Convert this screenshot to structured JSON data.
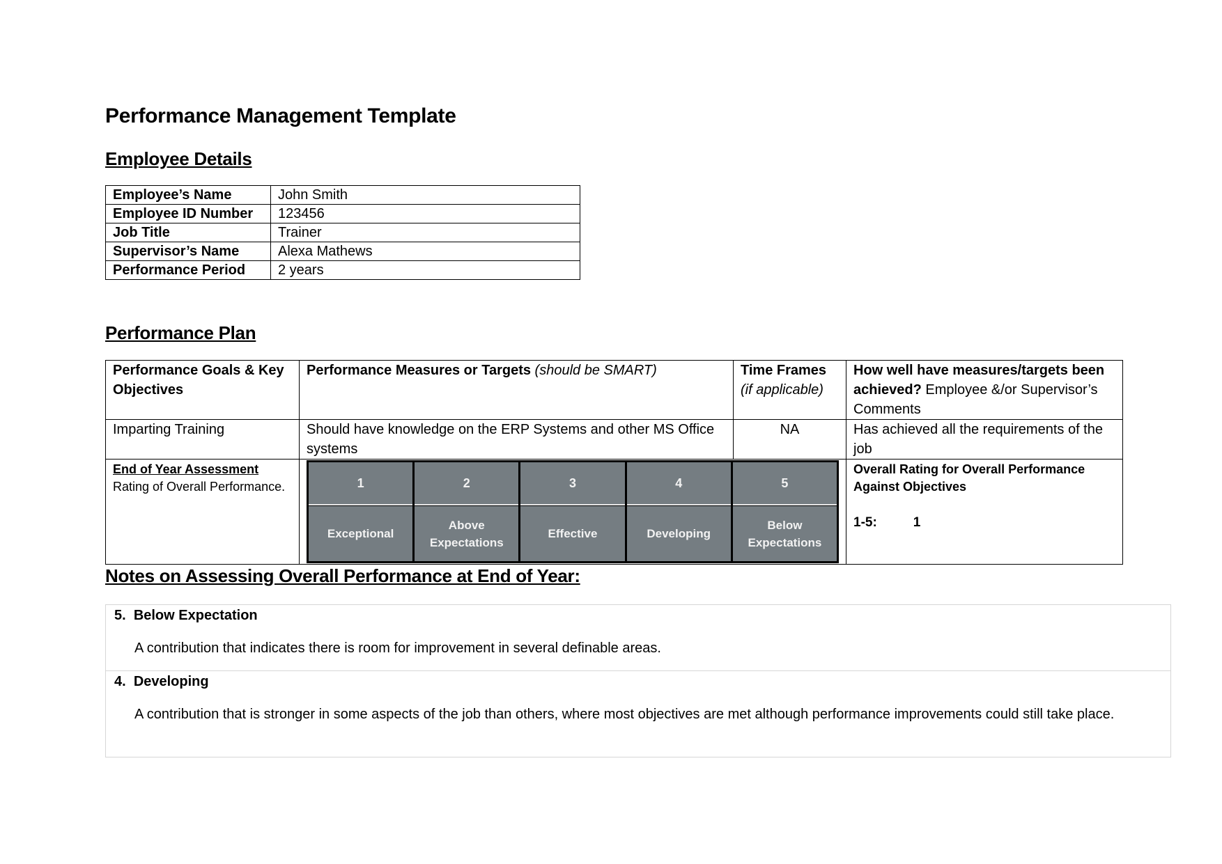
{
  "document": {
    "title": "Performance Management Template"
  },
  "employee_details": {
    "heading": "Employee Details",
    "rows": [
      {
        "label": "Employee’s Name",
        "value": "John Smith"
      },
      {
        "label": "Employee ID Number",
        "value": "123456"
      },
      {
        "label": "Job Title",
        "value": "Trainer"
      },
      {
        "label": "Supervisor’s Name",
        "value": "Alexa Mathews"
      },
      {
        "label": "Performance Period",
        "value": "2 years"
      }
    ]
  },
  "performance_plan": {
    "heading": "Performance Plan",
    "headers": {
      "goals": "Performance Goals & Key Objectives",
      "measures_bold": "Performance Measures or Targets",
      "measures_italic": "(should be SMART)",
      "timeframes_bold": "Time Frames",
      "timeframes_italic": "(if applicable)",
      "achieved_bold": "How well have measures/targets been achieved?",
      "achieved_rest": "Employee &/or Supervisor’s Comments"
    },
    "rows": [
      {
        "goal": "Imparting Training",
        "measure": "Should have knowledge on the ERP Systems and other MS Office systems",
        "timeframe": "NA",
        "comment": "Has achieved all the requirements of the job"
      }
    ],
    "assessment": {
      "title": "End of Year Assessment",
      "description": "Rating of Overall Performance.",
      "scale": [
        {
          "number": "1",
          "label": "Exceptional"
        },
        {
          "number": "2",
          "label": "Above Expectations"
        },
        {
          "number": "3",
          "label": "Effective"
        },
        {
          "number": "4",
          "label": "Developing"
        },
        {
          "number": "5",
          "label": "Below Expectations"
        }
      ],
      "overall_title": "Overall Rating for Overall Performance Against Objectives",
      "score_label": "1-5:",
      "score_value": "1"
    }
  },
  "notes": {
    "heading": "Notes on Assessing Overall Performance at End of Year:",
    "items": [
      {
        "number": "5.",
        "title": "Below Expectation",
        "text": "A contribution that indicates there is room for improvement in several definable areas."
      },
      {
        "number": "4.",
        "title": "Developing",
        "text": "A contribution that is stronger in some aspects of the job than others, where most objectives are met although performance improvements could still take place."
      }
    ]
  },
  "colors": {
    "rating_cell_fill": "#757d82",
    "rating_text": "#f2f2f2"
  }
}
